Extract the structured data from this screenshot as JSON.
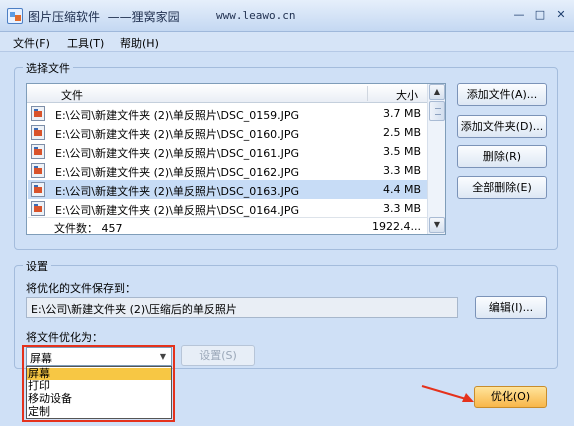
{
  "window": {
    "title": "图片压缩软件  ——狸窝家园",
    "url": "www.leawo.cn",
    "controls": {
      "minimize": "—",
      "maximize": "□",
      "close": "✕"
    }
  },
  "menu": [
    "文件(F)",
    "工具(T)",
    "帮助(H)"
  ],
  "file_group": {
    "title": "选择文件",
    "columns": {
      "file": "文件",
      "size": "大小"
    },
    "rows": [
      {
        "path": "E:\\公司\\新建文件夹 (2)\\单反照片\\DSC_0159.JPG",
        "size": "3.7 MB",
        "selected": false
      },
      {
        "path": "E:\\公司\\新建文件夹 (2)\\单反照片\\DSC_0160.JPG",
        "size": "2.5 MB",
        "selected": false
      },
      {
        "path": "E:\\公司\\新建文件夹 (2)\\单反照片\\DSC_0161.JPG",
        "size": "3.5 MB",
        "selected": false
      },
      {
        "path": "E:\\公司\\新建文件夹 (2)\\单反照片\\DSC_0162.JPG",
        "size": "3.3 MB",
        "selected": false
      },
      {
        "path": "E:\\公司\\新建文件夹 (2)\\单反照片\\DSC_0163.JPG",
        "size": "4.4 MB",
        "selected": true
      },
      {
        "path": "E:\\公司\\新建文件夹 (2)\\单反照片\\DSC_0164.JPG",
        "size": "3.3 MB",
        "selected": false
      }
    ],
    "footer": {
      "count": "文件数： 457",
      "total": "1922.4..."
    },
    "buttons": {
      "add_file": "添加文件(A)...",
      "add_folder": "添加文件夹(D)...",
      "delete": "删除(R)",
      "delete_all": "全部删除(E)"
    }
  },
  "settings_group": {
    "title": "设置",
    "save_label": "将优化的文件保存到：",
    "save_path": "E:\\公司\\新建文件夹 (2)\\压缩后的单反照片",
    "edit_button": "编辑(I)...",
    "optimize_label": "将文件优化为：",
    "selected_option": "屏幕",
    "options": [
      "屏幕",
      "打印",
      "移动设备",
      "定制"
    ],
    "settings_button": "设置(S)"
  },
  "optimize_button": "优化(O)",
  "colors": {
    "highlight": "#e5321c",
    "option_highlight": "#f7c744"
  }
}
